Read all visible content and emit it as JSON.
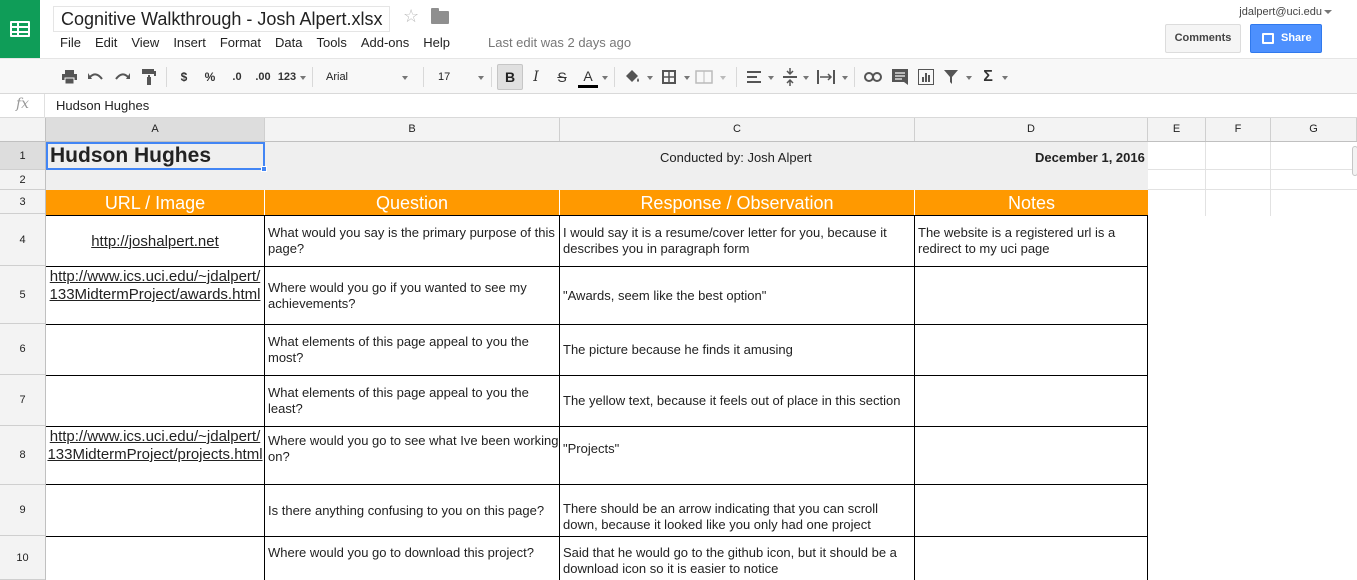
{
  "app": {
    "doc_title": "Cognitive Walkthrough - Josh Alpert.xlsx",
    "last_edit": "Last edit was 2 days ago",
    "user_email": "jdalpert@uci.edu",
    "comments_label": "Comments",
    "share_label": "Share",
    "menus": [
      "File",
      "Edit",
      "View",
      "Insert",
      "Format",
      "Data",
      "Tools",
      "Add-ons",
      "Help"
    ]
  },
  "toolbar": {
    "currency": "$",
    "percent": "%",
    "dec_decrease": ".0",
    "dec_increase": ".00",
    "number_format": "123",
    "font_family": "Arial",
    "font_size": "17",
    "bold": "B",
    "italic": "I",
    "strike": "S",
    "text_color": "A",
    "sum": "Σ"
  },
  "formula_bar": {
    "fx": "fx",
    "value": "Hudson Hughes"
  },
  "columns": [
    "A",
    "B",
    "C",
    "D",
    "E",
    "F",
    "G"
  ],
  "rows": [
    "1",
    "2",
    "3",
    "4",
    "5",
    "6",
    "7",
    "8",
    "9",
    "10"
  ],
  "sheet": {
    "a1": "Hudson Hughes",
    "c1": "Conducted by: Josh Alpert",
    "d1": "December 1, 2016",
    "headers": [
      "URL / Image",
      "Question",
      "Response / Observation",
      "Notes"
    ],
    "r4": {
      "url": "http://joshalpert.net",
      "question": "What would you say is the primary purpose of this page?",
      "response": "I would say it is a resume/cover letter for you, because it describes you in paragraph form",
      "notes": "The website is a registered url is a redirect to my uci page"
    },
    "r5": {
      "url": "http://www.ics.uci.edu/~jdalpert/133MidtermProject/awards.html",
      "question": "Where would you go if you wanted to see my achievements?",
      "response": "\"Awards, seem like the best option\"",
      "notes": ""
    },
    "r6": {
      "url": "",
      "question": "What elements of this page appeal to you the most?",
      "response": "The picture because he finds it amusing",
      "notes": ""
    },
    "r7": {
      "url": "",
      "question": "What elements of this page appeal to you the least?",
      "response": "The yellow text, because it feels out of place in this section",
      "notes": ""
    },
    "r8": {
      "url": "http://www.ics.uci.edu/~jdalpert/133MidtermProject/projects.html",
      "question": "Where would you go to see what Ive been working on?",
      "response": "\"Projects\"",
      "notes": ""
    },
    "r9": {
      "url": "",
      "question": "Is there anything confusing to you on this page?",
      "response": "There should be an arrow indicating that you can scroll down, because it looked like you only had one project",
      "notes": ""
    },
    "r10": {
      "url": "",
      "question": "Where would you go to download this project?",
      "response": "Said that he would go to the github icon, but it should be a download icon so it is easier to notice",
      "notes": ""
    }
  }
}
